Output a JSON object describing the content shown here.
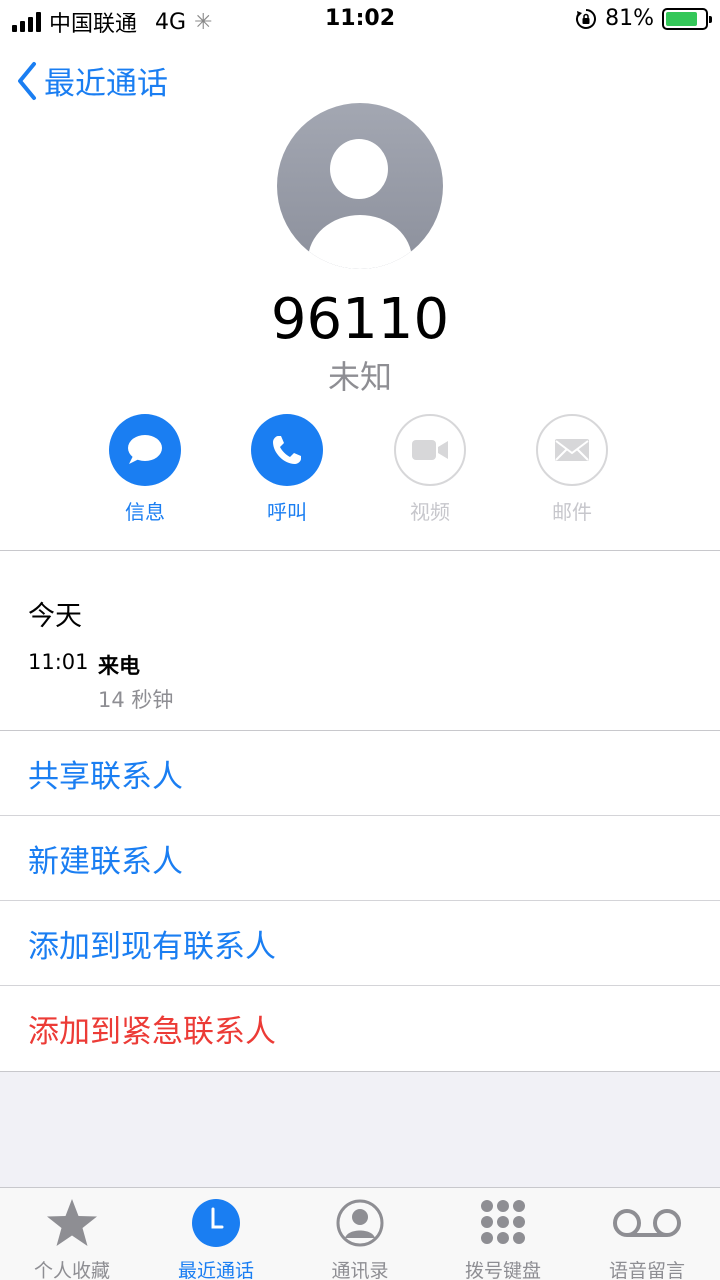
{
  "status_bar": {
    "carrier": "中国联通",
    "network": "4G",
    "time": "11:02",
    "battery_percent": "81%",
    "battery_level": 0.81
  },
  "nav": {
    "back_label": "最近通话"
  },
  "contact": {
    "number": "96110",
    "label": "未知"
  },
  "actions": [
    {
      "label": "信息",
      "icon": "message-icon",
      "enabled": true
    },
    {
      "label": "呼叫",
      "icon": "phone-icon",
      "enabled": true
    },
    {
      "label": "视频",
      "icon": "video-icon",
      "enabled": false
    },
    {
      "label": "邮件",
      "icon": "mail-icon",
      "enabled": false
    }
  ],
  "history": {
    "title": "今天",
    "entries": [
      {
        "time": "11:01",
        "type": "来电",
        "duration": "14 秒钟"
      }
    ]
  },
  "options": [
    {
      "label": "共享联系人",
      "color": "#1a7ef2"
    },
    {
      "label": "新建联系人",
      "color": "#1a7ef2"
    },
    {
      "label": "添加到现有联系人",
      "color": "#1a7ef2"
    },
    {
      "label": "添加到紧急联系人",
      "color": "#ec3b36"
    }
  ],
  "tabbar": {
    "items": [
      {
        "label": "个人收藏",
        "icon": "star-icon",
        "active": false
      },
      {
        "label": "最近通话",
        "icon": "clock-icon",
        "active": true
      },
      {
        "label": "通讯录",
        "icon": "contacts-icon",
        "active": false
      },
      {
        "label": "拨号键盘",
        "icon": "keypad-icon",
        "active": false
      },
      {
        "label": "语音留言",
        "icon": "voicemail-icon",
        "active": false
      }
    ]
  },
  "colors": {
    "accent": "#1a7ef2",
    "destructive": "#ec3b36",
    "battery": "#34c759"
  }
}
